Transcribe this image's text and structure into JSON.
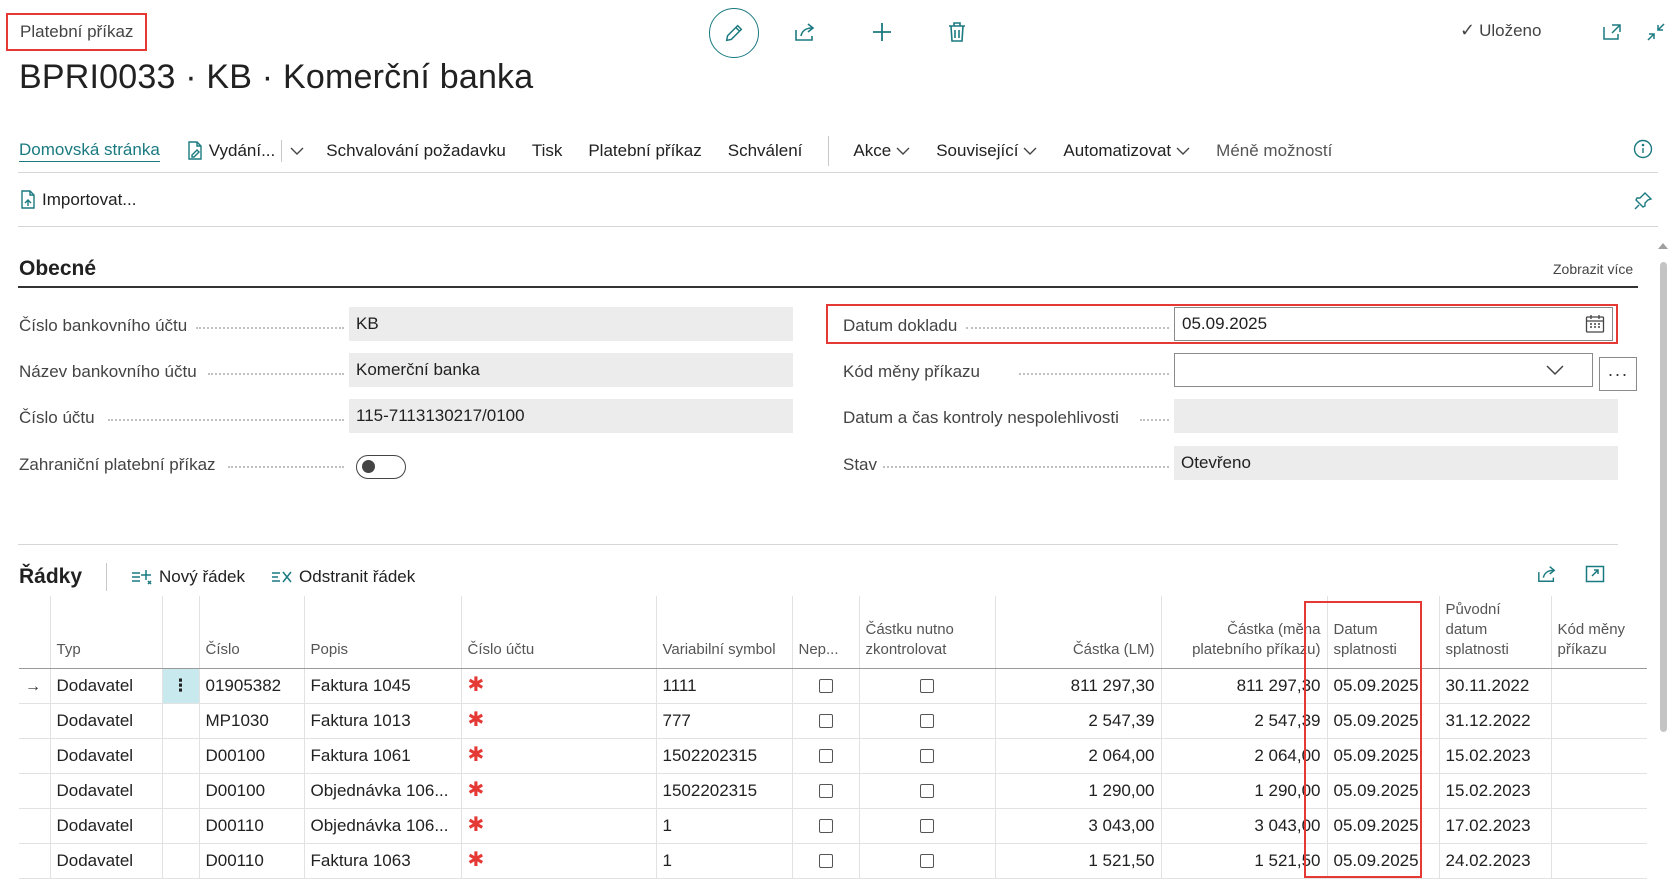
{
  "header": {
    "breadcrumb": "Platební příkaz",
    "title": "BPRI0033 · KB · Komerční banka",
    "saved_label": "Uloženo"
  },
  "actionbar": {
    "home": "Domovská stránka",
    "issue": "Vydání...",
    "approval_request": "Schvalování požadavku",
    "print": "Tisk",
    "payment_order": "Platební příkaz",
    "approval": "Schválení",
    "actions": "Akce",
    "related": "Související",
    "automate": "Automatizovat",
    "fewer_options": "Méně možností",
    "import": "Importovat..."
  },
  "general": {
    "title": "Obecné",
    "show_more": "Zobrazit více",
    "bank_account_no_label": "Číslo bankovního účtu",
    "bank_account_no": "KB",
    "bank_account_name_label": "Název bankovního účtu",
    "bank_account_name": "Komerční banka",
    "account_no_label": "Číslo účtu",
    "account_no": "115-7113130217/0100",
    "foreign_label": "Zahraniční platební příkaz",
    "foreign": false,
    "document_date_label": "Datum dokladu",
    "document_date": "05.09.2025",
    "currency_code_label": "Kód měny příkazu",
    "currency_code": "",
    "unreliability_check_label": "Datum a čas kontroly nespolehlivosti",
    "unreliability_check": "",
    "status_label": "Stav",
    "status": "Otevřeno"
  },
  "lines": {
    "title": "Řádky",
    "new_line": "Nový řádek",
    "delete_line": "Odstranit řádek",
    "headers": {
      "type": "Typ",
      "no": "Číslo",
      "description": "Popis",
      "account_no": "Číslo účtu",
      "variable_symbol": "Variabilní symbol",
      "skip": "Nep...",
      "amount_must_check": "Částku nutno zkontrolovat",
      "amount_lcy": "Částka (LM)",
      "amount_order_currency": "Částka (měna platebního příkazu)",
      "due_date": "Datum splatnosti",
      "original_due_date": "Původní datum splatnosti",
      "currency_code": "Kód měny příkazu"
    },
    "rows": [
      {
        "type": "Dodavatel",
        "no": "01905382",
        "description": "Faktura 1045",
        "variable_symbol": "1111",
        "amount_lcy": "811 297,30",
        "amount_oc": "811 297,30",
        "due_date": "05.09.2025",
        "original_due_date": "30.11.2022",
        "currency": ""
      },
      {
        "type": "Dodavatel",
        "no": "MP1030",
        "description": "Faktura 1013",
        "variable_symbol": "777",
        "amount_lcy": "2 547,39",
        "amount_oc": "2 547,39",
        "due_date": "05.09.2025",
        "original_due_date": "31.12.2022",
        "currency": ""
      },
      {
        "type": "Dodavatel",
        "no": "D00100",
        "description": "Faktura 1061",
        "variable_symbol": "1502202315",
        "amount_lcy": "2 064,00",
        "amount_oc": "2 064,00",
        "due_date": "05.09.2025",
        "original_due_date": "15.02.2023",
        "currency": ""
      },
      {
        "type": "Dodavatel",
        "no": "D00100",
        "description": "Objednávka 106...",
        "variable_symbol": "1502202315",
        "amount_lcy": "1 290,00",
        "amount_oc": "1 290,00",
        "due_date": "05.09.2025",
        "original_due_date": "15.02.2023",
        "currency": ""
      },
      {
        "type": "Dodavatel",
        "no": "D00110",
        "description": "Objednávka 106...",
        "variable_symbol": "1",
        "amount_lcy": "3 043,00",
        "amount_oc": "3 043,00",
        "due_date": "05.09.2025",
        "original_due_date": "17.02.2023",
        "currency": ""
      },
      {
        "type": "Dodavatel",
        "no": "D00110",
        "description": "Faktura 1063",
        "variable_symbol": "1",
        "amount_lcy": "1 521,50",
        "amount_oc": "1 521,50",
        "due_date": "05.09.2025",
        "original_due_date": "24.02.2023",
        "currency": ""
      }
    ]
  },
  "colors": {
    "accent": "#1a7a80",
    "highlight": "#e53935",
    "required": "#e53935"
  }
}
